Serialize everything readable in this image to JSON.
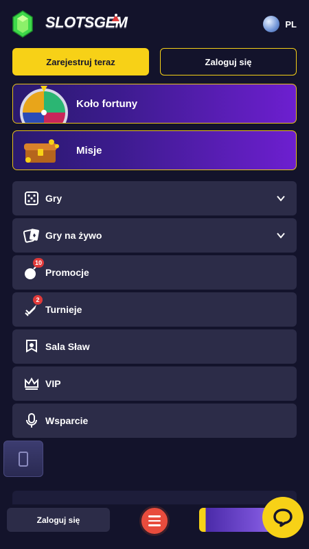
{
  "header": {
    "logo_text": "SLOTSGEM",
    "language": "PL"
  },
  "auth": {
    "register_label": "Zarejestruj teraz",
    "login_label": "Zaloguj się"
  },
  "promos": [
    {
      "label": "Koło fortuny",
      "icon": "wheel-of-fortune"
    },
    {
      "label": "Misje",
      "icon": "treasure-chest"
    }
  ],
  "menu": [
    {
      "label": "Gry",
      "icon": "dice-icon",
      "expandable": true
    },
    {
      "label": "Gry na żywo",
      "icon": "cards-icon",
      "expandable": true
    },
    {
      "label": "Promocje",
      "icon": "bomb-icon",
      "badge": "10"
    },
    {
      "label": "Turnieje",
      "icon": "rocket-icon",
      "badge": "2"
    },
    {
      "label": "Sala Sław",
      "icon": "banner-icon"
    },
    {
      "label": "VIP",
      "icon": "crown-icon"
    },
    {
      "label": "Wsparcie",
      "icon": "microphone-icon"
    }
  ],
  "bottom_bar": {
    "login_label": "Zaloguj się"
  },
  "colors": {
    "background": "#13132b",
    "accent": "#f7d117",
    "menu_item": "#2c2c48",
    "badge": "#e03a3a",
    "menu_fab": "#e84c3d"
  }
}
